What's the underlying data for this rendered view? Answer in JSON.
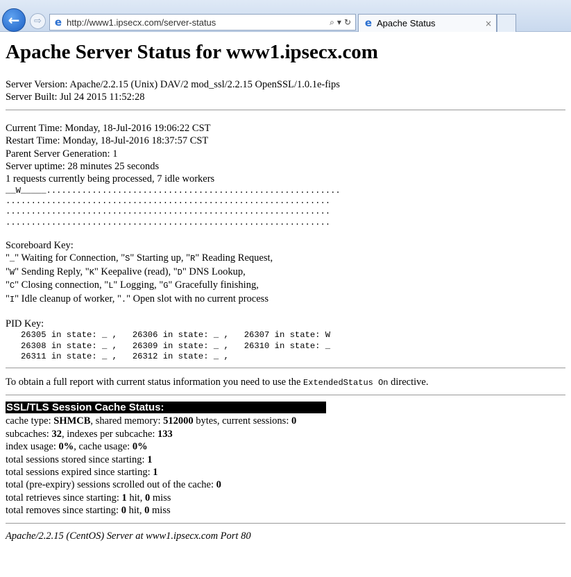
{
  "browser": {
    "url": "http://www1.ipsecx.com/server-status",
    "tab_title": "Apache Status",
    "search_glyph": "⌕",
    "dropdown_glyph": "▾",
    "refresh_glyph": "↻",
    "close_glyph": "×",
    "back_glyph": "←",
    "forward_glyph": "⇨",
    "ie_glyph": "e"
  },
  "page": {
    "title": "Apache Server Status for www1.ipsecx.com",
    "server_version": "Server Version: Apache/2.2.15 (Unix) DAV/2 mod_ssl/2.2.15 OpenSSL/1.0.1e-fips",
    "server_built": "Server Built: Jul 24 2015 11:52:28",
    "current_time": "Current Time: Monday, 18-Jul-2016 19:06:22 CST",
    "restart_time": "Restart Time: Monday, 18-Jul-2016 18:37:57 CST",
    "parent_generation": "Parent Server Generation: 1",
    "uptime": "Server uptime: 28 minutes 25 seconds",
    "requests": "1 requests currently being processed, 7 idle workers",
    "scoreboard": "__W_____..........................................................\n................................................................\n................................................................\n................................................................",
    "scoreboard_key": {
      "title": "Scoreboard Key:",
      "line1_a_code": "_",
      "line1_a_text": "\" Waiting for Connection, \"",
      "line1_b_code": "S",
      "line1_b_text": "\" Starting up, \"",
      "line1_c_code": "R",
      "line1_c_text": "\" Reading Request,",
      "line2_a_code": "W",
      "line2_a_text": "\" Sending Reply, \"",
      "line2_b_code": "K",
      "line2_b_text": "\" Keepalive (read), \"",
      "line2_c_code": "D",
      "line2_c_text": "\" DNS Lookup,",
      "line3_a_code": "C",
      "line3_a_text": "\" Closing connection, \"",
      "line3_b_code": "L",
      "line3_b_text": "\" Logging, \"",
      "line3_c_code": "G",
      "line3_c_text": "\" Gracefully finishing,",
      "line4_a_code": "I",
      "line4_a_text": "\" Idle cleanup of worker, \"",
      "line4_b_code": ".",
      "line4_b_text": "\" Open slot with no current process"
    },
    "pid_key_title": "PID Key:",
    "pid_table": "   26305 in state: _ ,   26306 in state: _ ,   26307 in state: W\n   26308 in state: _ ,   26309 in state: _ ,   26310 in state: _\n   26311 in state: _ ,   26312 in state: _ ,",
    "note_before": "To obtain a full report with current status information you need to use the ",
    "note_code": "ExtendedStatus On",
    "note_after": " directive.",
    "ssl": {
      "header": "SSL/TLS Session Cache Status:",
      "l1_a": "cache type: ",
      "l1_b": "SHMCB",
      "l1_c": ", shared memory: ",
      "l1_d": "512000",
      "l1_e": " bytes, current sessions: ",
      "l1_f": "0",
      "l2_a": "subcaches: ",
      "l2_b": "32",
      "l2_c": ", indexes per subcache: ",
      "l2_d": "133",
      "l3_a": "index usage: ",
      "l3_b": "0%",
      "l3_c": ", cache usage: ",
      "l3_d": "0%",
      "l4_a": "total sessions stored since starting: ",
      "l4_b": "1",
      "l5_a": "total sessions expired since starting: ",
      "l5_b": "1",
      "l6_a": "total (pre-expiry) sessions scrolled out of the cache: ",
      "l6_b": "0",
      "l7_a": "total retrieves since starting: ",
      "l7_b": "1",
      "l7_c": " hit, ",
      "l7_d": "0",
      "l7_e": " miss",
      "l8_a": "total removes since starting: ",
      "l8_b": "0",
      "l8_c": " hit, ",
      "l8_d": "0",
      "l8_e": " miss"
    },
    "footer": "Apache/2.2.15 (CentOS) Server at www1.ipsecx.com Port 80"
  }
}
